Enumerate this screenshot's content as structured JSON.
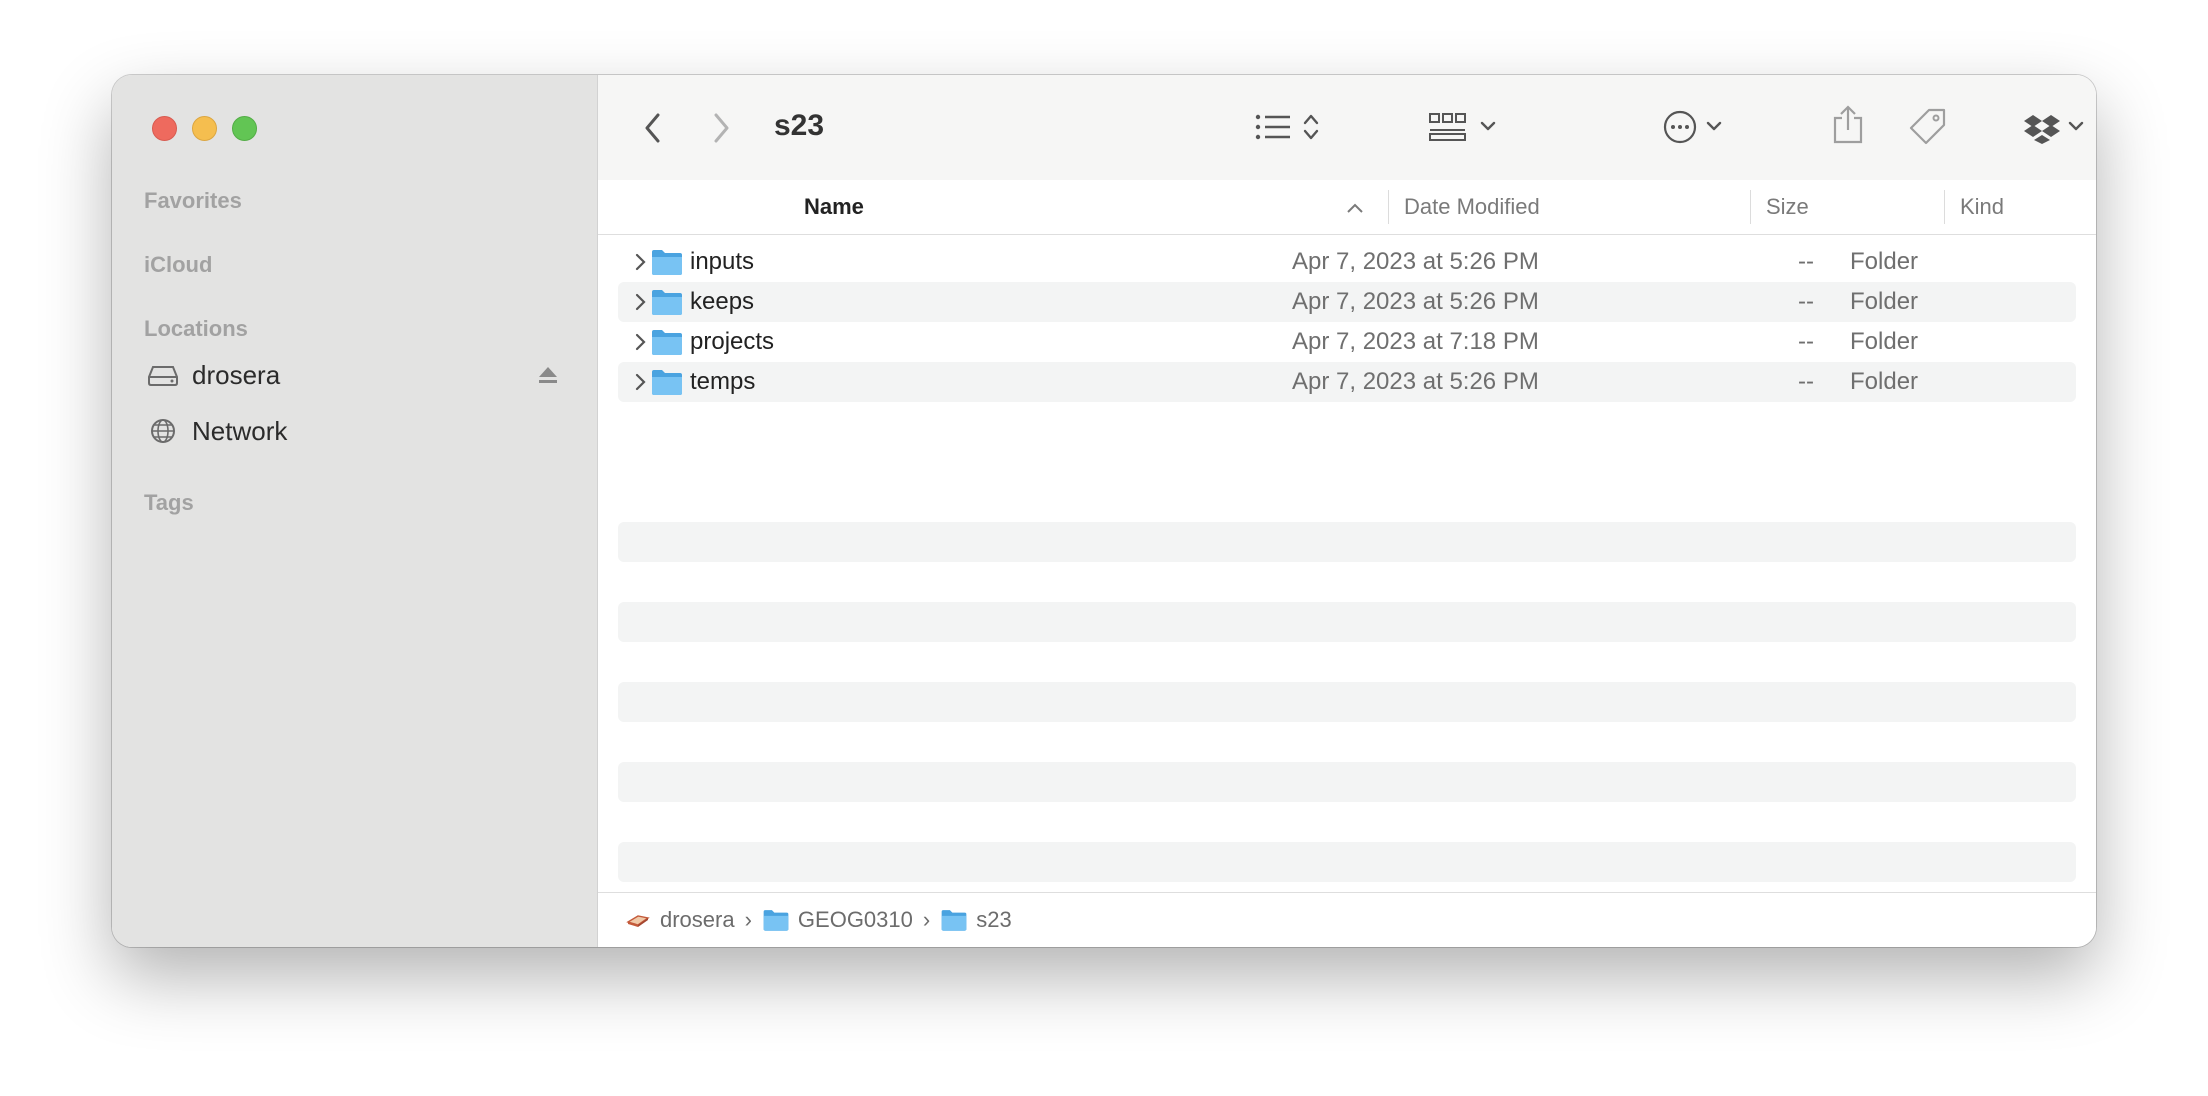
{
  "window": {
    "title": "s23"
  },
  "sidebar": {
    "sections": {
      "favorites": "Favorites",
      "icloud": "iCloud",
      "locations": "Locations",
      "tags": "Tags"
    },
    "locations": [
      {
        "label": "drosera",
        "icon": "drive-icon"
      },
      {
        "label": "Network",
        "icon": "globe-icon"
      }
    ]
  },
  "columns": {
    "name": "Name",
    "date_modified": "Date Modified",
    "size": "Size",
    "kind": "Kind"
  },
  "rows": [
    {
      "name": "inputs",
      "date": "Apr 7, 2023 at 5:26 PM",
      "size": "--",
      "kind": "Folder"
    },
    {
      "name": "keeps",
      "date": "Apr 7, 2023 at 5:26 PM",
      "size": "--",
      "kind": "Folder"
    },
    {
      "name": "projects",
      "date": "Apr 7, 2023 at 7:18 PM",
      "size": "--",
      "kind": "Folder"
    },
    {
      "name": "temps",
      "date": "Apr 7, 2023 at 5:26 PM",
      "size": "--",
      "kind": "Folder"
    }
  ],
  "pathbar": [
    {
      "label": "drosera",
      "icon": "drive-icon"
    },
    {
      "label": "GEOG0310",
      "icon": "folder-icon"
    },
    {
      "label": "s23",
      "icon": "folder-icon"
    }
  ],
  "colors": {
    "folder": "#63b8f0",
    "sidebar_bg": "#e3e3e2",
    "row_alt": "#f3f4f4"
  }
}
